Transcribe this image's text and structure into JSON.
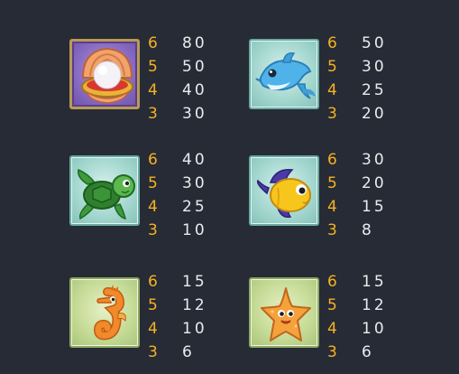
{
  "colors": {
    "background": "#262b35",
    "count_text": "#f6b321",
    "payout_text": "#e9ebee"
  },
  "paytable": [
    {
      "symbol": "pearl-in-shell",
      "icon": "pearl-shell-icon",
      "rows": [
        {
          "count": "6",
          "payout": "80"
        },
        {
          "count": "5",
          "payout": "50"
        },
        {
          "count": "4",
          "payout": "40"
        },
        {
          "count": "3",
          "payout": "30"
        }
      ]
    },
    {
      "symbol": "dolphin",
      "icon": "dolphin-icon",
      "rows": [
        {
          "count": "6",
          "payout": "50"
        },
        {
          "count": "5",
          "payout": "30"
        },
        {
          "count": "4",
          "payout": "25"
        },
        {
          "count": "3",
          "payout": "20"
        }
      ]
    },
    {
      "symbol": "turtle",
      "icon": "turtle-icon",
      "rows": [
        {
          "count": "6",
          "payout": "40"
        },
        {
          "count": "5",
          "payout": "30"
        },
        {
          "count": "4",
          "payout": "25"
        },
        {
          "count": "3",
          "payout": "10"
        }
      ]
    },
    {
      "symbol": "yellow-fish",
      "icon": "yellow-fish-icon",
      "rows": [
        {
          "count": "6",
          "payout": "30"
        },
        {
          "count": "5",
          "payout": "20"
        },
        {
          "count": "4",
          "payout": "15"
        },
        {
          "count": "3",
          "payout": "8"
        }
      ]
    },
    {
      "symbol": "seahorse",
      "icon": "seahorse-icon",
      "rows": [
        {
          "count": "6",
          "payout": "15"
        },
        {
          "count": "5",
          "payout": "12"
        },
        {
          "count": "4",
          "payout": "10"
        },
        {
          "count": "3",
          "payout": "6"
        }
      ]
    },
    {
      "symbol": "starfish",
      "icon": "starfish-icon",
      "rows": [
        {
          "count": "6",
          "payout": "15"
        },
        {
          "count": "5",
          "payout": "12"
        },
        {
          "count": "4",
          "payout": "10"
        },
        {
          "count": "3",
          "payout": "6"
        }
      ]
    }
  ]
}
